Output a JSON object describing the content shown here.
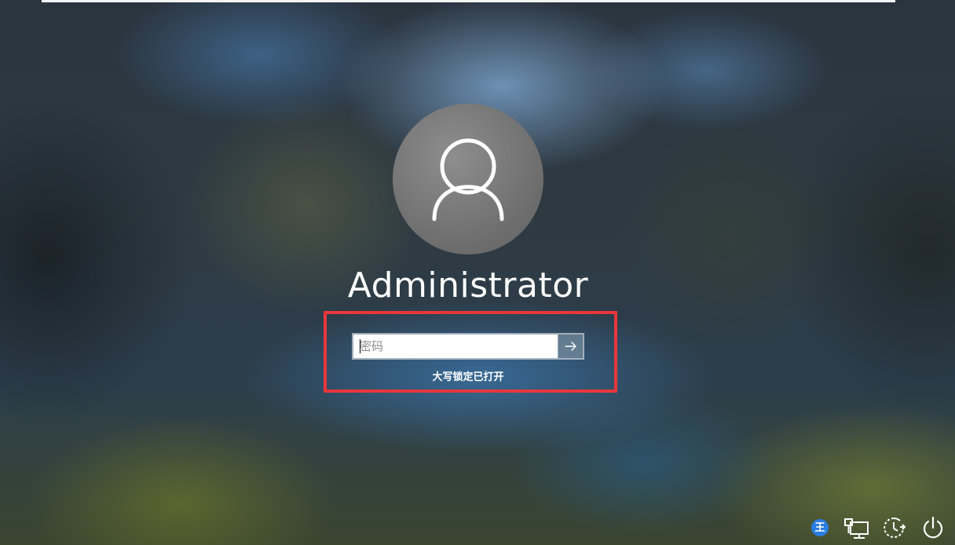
{
  "user": {
    "name": "Administrator"
  },
  "login": {
    "password_placeholder": "密码",
    "password_value": "",
    "submit_icon": "arrow-right-icon",
    "capslock_message": "大写锁定已打开"
  },
  "tray": {
    "ime_label": "王",
    "icons": [
      "input-method-icon",
      "network-icon",
      "ease-of-access-icon",
      "power-icon"
    ]
  },
  "colors": {
    "highlight_border": "#e8373c",
    "ime_badge": "#2a7de1",
    "text": "#ffffff"
  }
}
